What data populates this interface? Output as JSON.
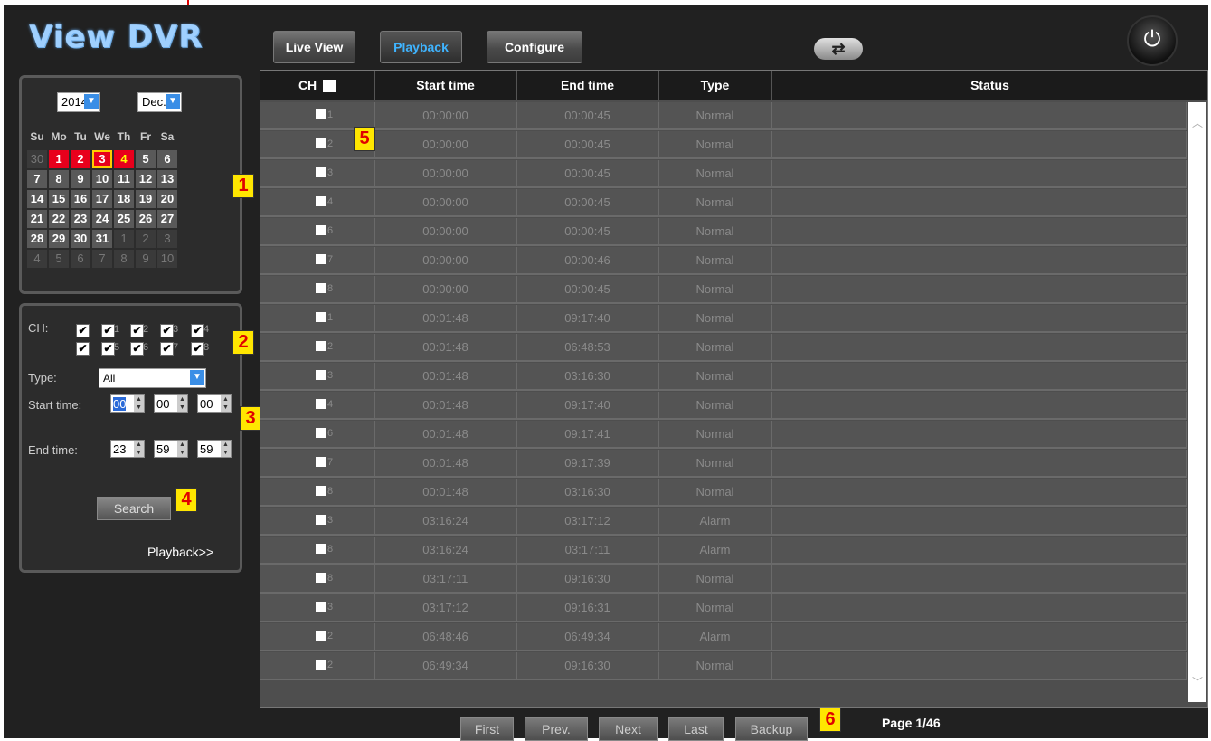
{
  "app": {
    "logo": "View DVR"
  },
  "nav": {
    "tabs": [
      {
        "label": "Live View"
      },
      {
        "label": "Playback"
      },
      {
        "label": "Configure"
      }
    ],
    "active": "Playback",
    "swap_icon": "swap-arrows-icon",
    "power_icon": "power-icon"
  },
  "calendar": {
    "year": "2014",
    "month": "Dec.",
    "weekdays": [
      "Su",
      "Mo",
      "Tu",
      "We",
      "Th",
      "Fr",
      "Sa"
    ],
    "weeks": [
      [
        "30",
        "1",
        "2",
        "3",
        "4",
        "5",
        "6"
      ],
      [
        "7",
        "8",
        "9",
        "10",
        "11",
        "12",
        "13"
      ],
      [
        "14",
        "15",
        "16",
        "17",
        "18",
        "19",
        "20"
      ],
      [
        "21",
        "22",
        "23",
        "24",
        "25",
        "26",
        "27"
      ],
      [
        "28",
        "29",
        "30",
        "31",
        "1",
        "2",
        "3"
      ],
      [
        "4",
        "5",
        "6",
        "7",
        "8",
        "9",
        "10"
      ]
    ],
    "recorded_days": [
      "1",
      "2",
      "3",
      "4"
    ],
    "selected_day": "3"
  },
  "search": {
    "ch_label": "CH:",
    "channels_row1": [
      "",
      "1",
      "2",
      "3",
      "4"
    ],
    "channels_row2": [
      "",
      "5",
      "6",
      "7",
      "8"
    ],
    "type_label": "Type:",
    "type_value": "All",
    "start_label": "Start time:",
    "start": [
      "00",
      "00",
      "00"
    ],
    "end_label": "End time:",
    "end": [
      "23",
      "59",
      "59"
    ],
    "search_button": "Search",
    "playback_link": "Playback>>"
  },
  "table": {
    "headers": [
      "CH",
      "Start time",
      "End time",
      "Type",
      "Status"
    ],
    "rows": [
      {
        "ch": "1",
        "start": "00:00:00",
        "end": "00:00:45",
        "type": "Normal",
        "status": ""
      },
      {
        "ch": "2",
        "start": "00:00:00",
        "end": "00:00:45",
        "type": "Normal",
        "status": ""
      },
      {
        "ch": "3",
        "start": "00:00:00",
        "end": "00:00:45",
        "type": "Normal",
        "status": ""
      },
      {
        "ch": "4",
        "start": "00:00:00",
        "end": "00:00:45",
        "type": "Normal",
        "status": ""
      },
      {
        "ch": "6",
        "start": "00:00:00",
        "end": "00:00:45",
        "type": "Normal",
        "status": ""
      },
      {
        "ch": "7",
        "start": "00:00:00",
        "end": "00:00:46",
        "type": "Normal",
        "status": ""
      },
      {
        "ch": "8",
        "start": "00:00:00",
        "end": "00:00:45",
        "type": "Normal",
        "status": ""
      },
      {
        "ch": "1",
        "start": "00:01:48",
        "end": "09:17:40",
        "type": "Normal",
        "status": ""
      },
      {
        "ch": "2",
        "start": "00:01:48",
        "end": "06:48:53",
        "type": "Normal",
        "status": ""
      },
      {
        "ch": "3",
        "start": "00:01:48",
        "end": "03:16:30",
        "type": "Normal",
        "status": ""
      },
      {
        "ch": "4",
        "start": "00:01:48",
        "end": "09:17:40",
        "type": "Normal",
        "status": ""
      },
      {
        "ch": "6",
        "start": "00:01:48",
        "end": "09:17:41",
        "type": "Normal",
        "status": ""
      },
      {
        "ch": "7",
        "start": "00:01:48",
        "end": "09:17:39",
        "type": "Normal",
        "status": ""
      },
      {
        "ch": "8",
        "start": "00:01:48",
        "end": "03:16:30",
        "type": "Normal",
        "status": ""
      },
      {
        "ch": "3",
        "start": "03:16:24",
        "end": "03:17:12",
        "type": "Alarm",
        "status": ""
      },
      {
        "ch": "8",
        "start": "03:16:24",
        "end": "03:17:11",
        "type": "Alarm",
        "status": ""
      },
      {
        "ch": "8",
        "start": "03:17:11",
        "end": "09:16:30",
        "type": "Normal",
        "status": ""
      },
      {
        "ch": "3",
        "start": "03:17:12",
        "end": "09:16:31",
        "type": "Normal",
        "status": ""
      },
      {
        "ch": "2",
        "start": "06:48:46",
        "end": "06:49:34",
        "type": "Alarm",
        "status": ""
      },
      {
        "ch": "2",
        "start": "06:49:34",
        "end": "09:16:30",
        "type": "Normal",
        "status": ""
      }
    ]
  },
  "pager": {
    "buttons": [
      "First",
      "Prev.",
      "Next",
      "Last",
      "Backup"
    ],
    "page_info": "Page 1/46"
  },
  "annotations": [
    "1",
    "2",
    "3",
    "4",
    "5",
    "6"
  ]
}
